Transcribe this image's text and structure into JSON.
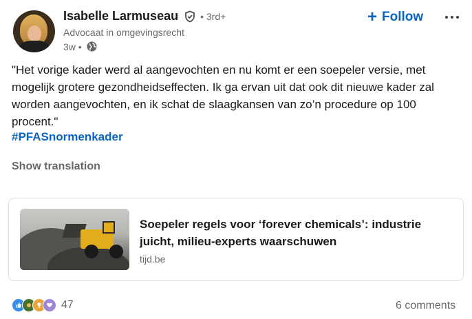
{
  "author": {
    "name": "Isabelle Larmuseau",
    "degree": "• 3rd+",
    "headline": "Advocaat in omgevingsrecht",
    "time": "3w •",
    "verified_icon": "verified-shield-icon",
    "visibility_icon": "globe-icon"
  },
  "actions": {
    "follow_label": "Follow",
    "follow_icon": "plus-icon",
    "more_icon": "more-horizontal-icon"
  },
  "post": {
    "text": "\"Het vorige kader werd al aangevochten en nu komt er een soepeler versie, met mogelijk grotere gezondheidseffecten. Ik ga ervan uit dat ook dit nieuwe kader zal worden aangevochten, en ik schat de slaagkansen van zo’n procedure op 100 procent.\"",
    "hashtag": "#PFASnormenkader",
    "show_translation": "Show translation"
  },
  "article": {
    "title": "Soepeler regels voor ‘forever chemicals’: industrie juicht, milieu-experts waarschuwen",
    "source": "tijd.be"
  },
  "social": {
    "reaction_count": "47",
    "comments": "6 comments",
    "reaction_icons": [
      "like-icon",
      "celebrate-icon",
      "insightful-icon",
      "support-icon"
    ]
  },
  "colors": {
    "accent": "#0a66c2",
    "secondary_text": "#666666",
    "border": "#e0dfdc"
  }
}
